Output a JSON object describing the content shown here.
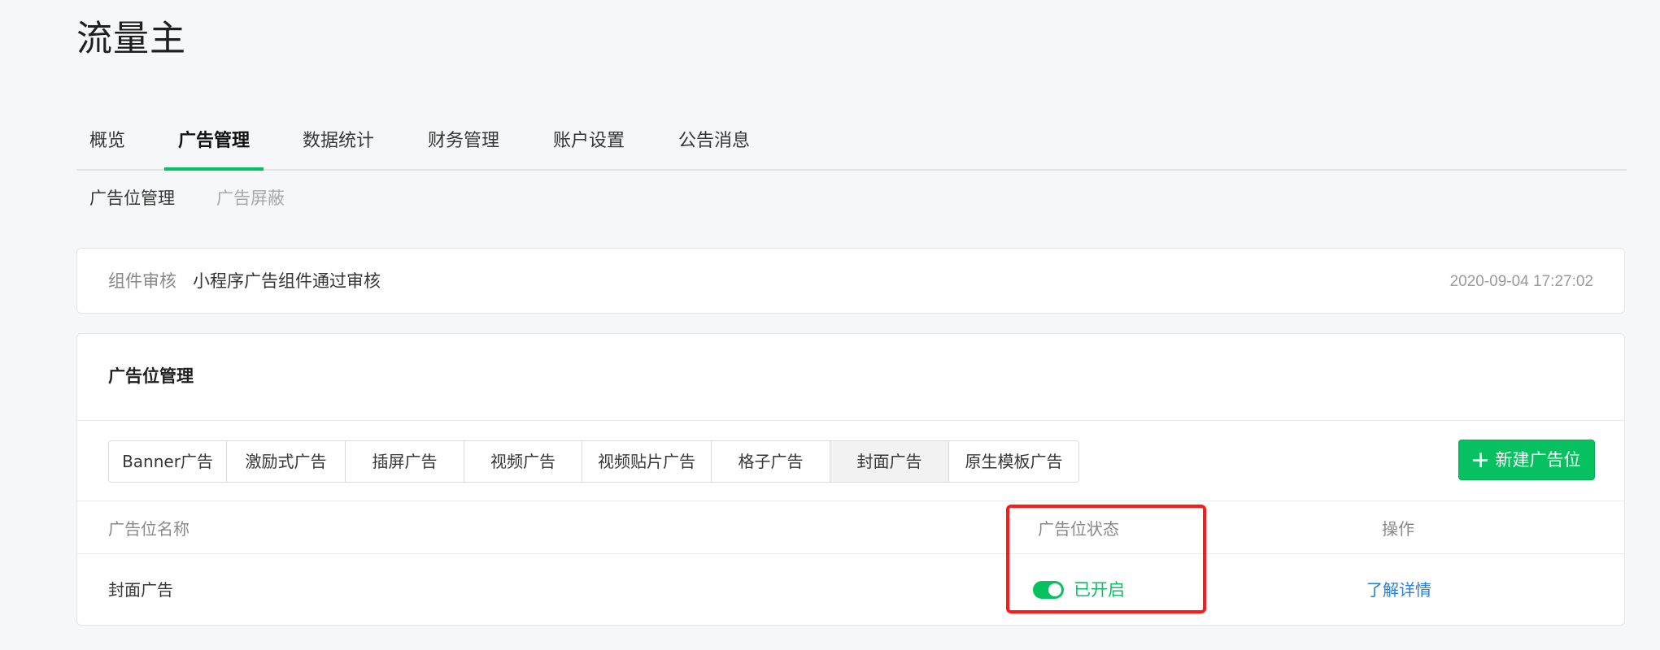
{
  "app": {
    "title": "流量主"
  },
  "main_tabs": [
    {
      "label": "概览",
      "active": false
    },
    {
      "label": "广告管理",
      "active": true
    },
    {
      "label": "数据统计",
      "active": false
    },
    {
      "label": "财务管理",
      "active": false
    },
    {
      "label": "账户设置",
      "active": false
    },
    {
      "label": "公告消息",
      "active": false
    }
  ],
  "sub_tabs": [
    {
      "label": "广告位管理",
      "active": true
    },
    {
      "label": "广告屏蔽",
      "active": false
    }
  ],
  "notice": {
    "label": "组件审核",
    "text": "小程序广告组件通过审核",
    "time": "2020-09-04 17:27:02"
  },
  "manage": {
    "title": "广告位管理",
    "ad_types": [
      {
        "label": "Banner广告",
        "selected": false
      },
      {
        "label": "激励式广告",
        "selected": false
      },
      {
        "label": "插屏广告",
        "selected": false
      },
      {
        "label": "视频广告",
        "selected": false
      },
      {
        "label": "视频贴片广告",
        "selected": false
      },
      {
        "label": "格子广告",
        "selected": false
      },
      {
        "label": "封面广告",
        "selected": true
      },
      {
        "label": "原生模板广告",
        "selected": false
      }
    ],
    "new_button_label": "新建广告位",
    "table": {
      "columns": [
        "广告位名称",
        "广告位状态",
        "操作"
      ],
      "rows": [
        {
          "name": "封面广告",
          "status": "已开启",
          "enabled": true,
          "action": "了解详情"
        }
      ]
    }
  },
  "colors": {
    "accent": "#07c160",
    "link": "#2b7fd3",
    "highlight": "#ff1a1a"
  }
}
